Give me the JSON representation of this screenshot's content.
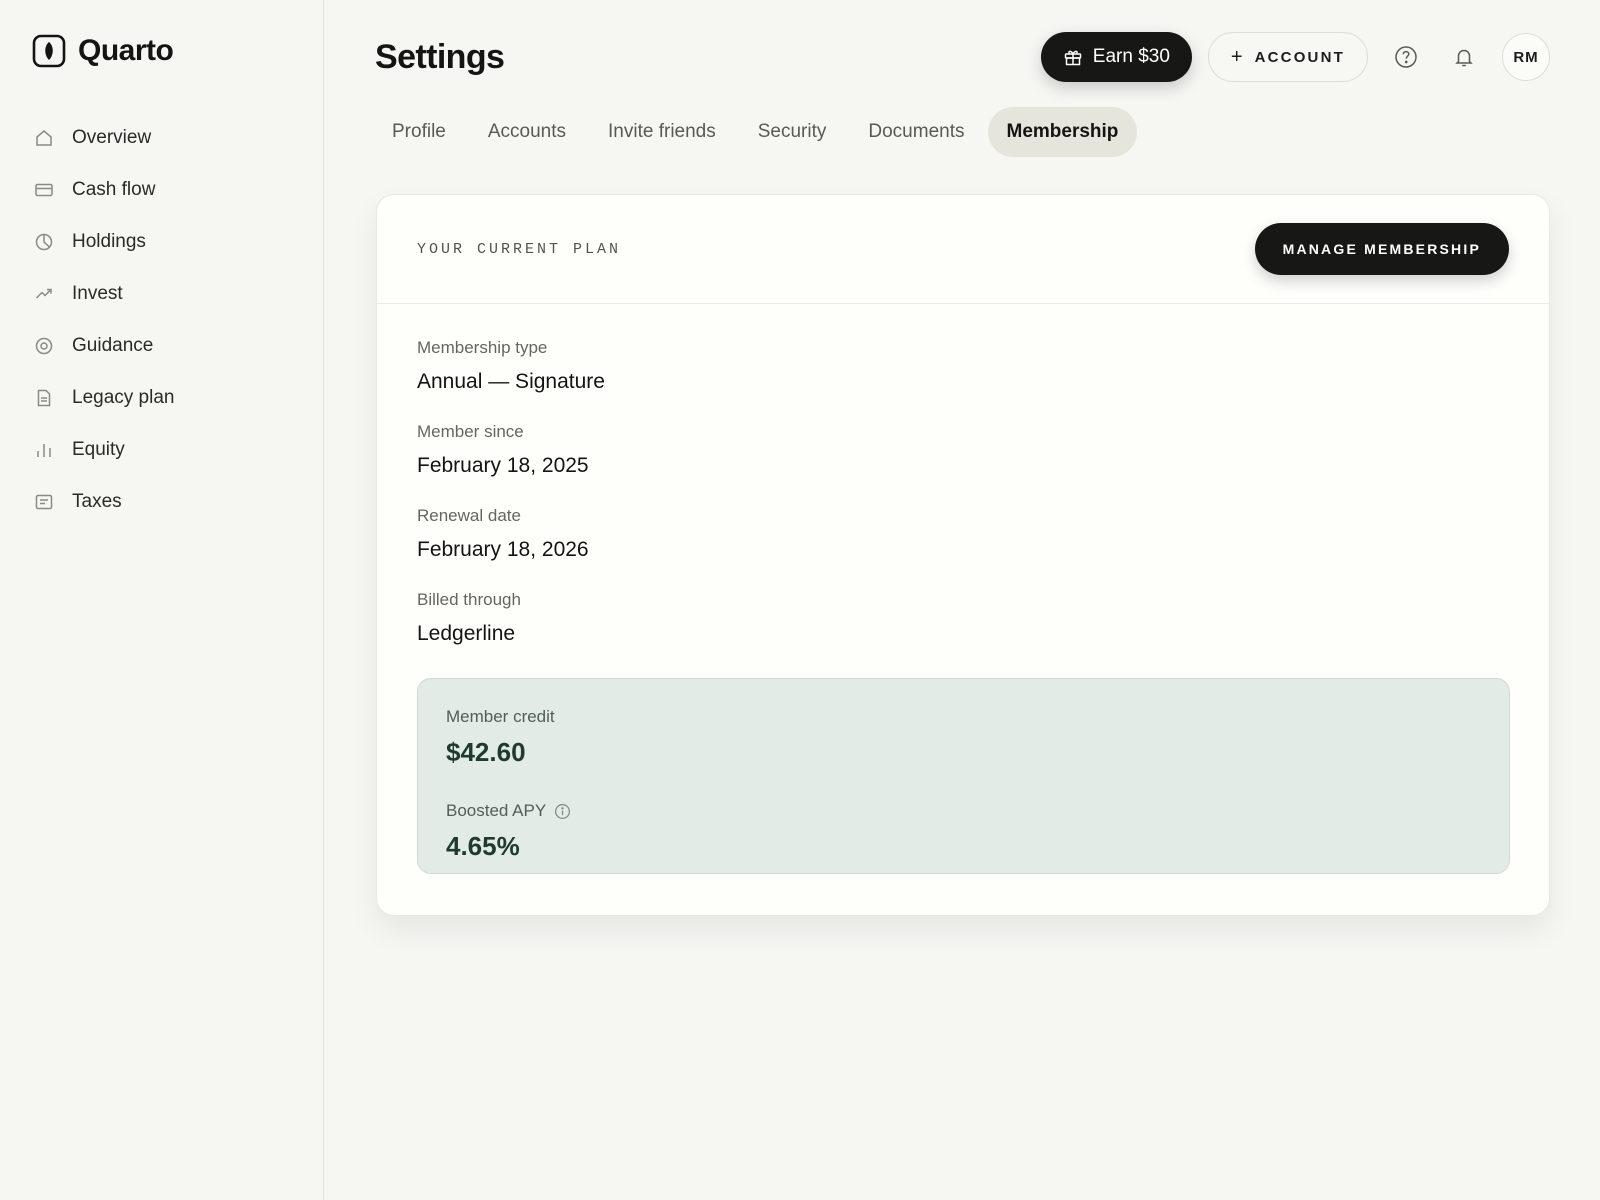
{
  "brand": {
    "name": "Quarto"
  },
  "sidebar": {
    "items": [
      {
        "label": "Overview",
        "icon": "home-icon"
      },
      {
        "label": "Cash flow",
        "icon": "card-icon"
      },
      {
        "label": "Holdings",
        "icon": "pie-icon"
      },
      {
        "label": "Invest",
        "icon": "trend-icon"
      },
      {
        "label": "Guidance",
        "icon": "target-icon"
      },
      {
        "label": "Legacy plan",
        "icon": "document-icon"
      },
      {
        "label": "Equity",
        "icon": "bars-icon"
      },
      {
        "label": "Taxes",
        "icon": "receipt-icon"
      }
    ]
  },
  "header": {
    "title": "Settings",
    "earn_label": "Earn $30",
    "account_plus": "+",
    "account_label": "ACCOUNT",
    "avatar_initials": "RM"
  },
  "tabs": [
    {
      "label": "Profile",
      "active": false
    },
    {
      "label": "Accounts",
      "active": false
    },
    {
      "label": "Invite friends",
      "active": false
    },
    {
      "label": "Security",
      "active": false
    },
    {
      "label": "Documents",
      "active": false
    },
    {
      "label": "Membership",
      "active": true
    }
  ],
  "plan": {
    "section_label": "YOUR CURRENT PLAN",
    "manage_label": "MANAGE MEMBERSHIP",
    "fields": [
      {
        "label": "Membership type",
        "value": "Annual — Signature"
      },
      {
        "label": "Member since",
        "value": "February 18, 2025"
      },
      {
        "label": "Renewal date",
        "value": "February 18, 2026"
      },
      {
        "label": "Billed through",
        "value": "Ledgerline"
      }
    ],
    "credit": {
      "credit_label": "Member credit",
      "credit_value": "$42.60",
      "apy_label": "Boosted APY",
      "apy_value": "4.65%"
    }
  },
  "colors": {
    "accent_dark": "#171715",
    "credit_bg": "#e2ebe6",
    "tab_active_bg": "#e6e5dc"
  }
}
